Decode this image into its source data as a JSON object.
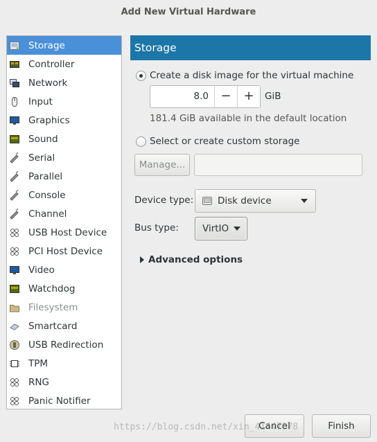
{
  "window": {
    "title": "Add New Virtual Hardware"
  },
  "sidebar": {
    "items": [
      {
        "label": "Storage",
        "icon": "storage-icon",
        "selected": true
      },
      {
        "label": "Controller",
        "icon": "controller-icon"
      },
      {
        "label": "Network",
        "icon": "network-icon"
      },
      {
        "label": "Input",
        "icon": "mouse-icon"
      },
      {
        "label": "Graphics",
        "icon": "monitor-icon"
      },
      {
        "label": "Sound",
        "icon": "chip-icon"
      },
      {
        "label": "Serial",
        "icon": "plug-icon"
      },
      {
        "label": "Parallel",
        "icon": "plug-icon"
      },
      {
        "label": "Console",
        "icon": "plug-icon"
      },
      {
        "label": "Channel",
        "icon": "plug-icon"
      },
      {
        "label": "USB Host Device",
        "icon": "usb-icon"
      },
      {
        "label": "PCI Host Device",
        "icon": "usb-icon"
      },
      {
        "label": "Video",
        "icon": "monitor-icon"
      },
      {
        "label": "Watchdog",
        "icon": "chip-icon"
      },
      {
        "label": "Filesystem",
        "icon": "folder-icon",
        "disabled": true
      },
      {
        "label": "Smartcard",
        "icon": "smartcard-icon"
      },
      {
        "label": "USB Redirection",
        "icon": "usb-redirect-icon"
      },
      {
        "label": "TPM",
        "icon": "tpm-chip-icon"
      },
      {
        "label": "RNG",
        "icon": "usb-icon"
      },
      {
        "label": "Panic Notifier",
        "icon": "usb-icon"
      }
    ]
  },
  "panel": {
    "header": "Storage",
    "create_disk_label": "Create a disk image for the virtual machine",
    "size_value": "8.0",
    "size_unit": "GiB",
    "decrement_label": "−",
    "increment_label": "+",
    "available_text": "181.4 GiB available in the default location",
    "custom_storage_label": "Select or create custom storage",
    "manage_label": "Manage...",
    "storage_path_value": "",
    "device_type_label": "Device type:",
    "device_type_value": "Disk device",
    "bus_type_label": "Bus type:",
    "bus_type_value": "VirtIO",
    "advanced_label": "Advanced options"
  },
  "footer": {
    "cancel_label": "Cancel",
    "finish_label": "Finish"
  },
  "watermark": "https://blog.csdn.net/xin_41447878",
  "colors": {
    "header_bg": "#1c76a8",
    "selection_bg": "#4a90d9",
    "window_bg": "#ededed"
  }
}
